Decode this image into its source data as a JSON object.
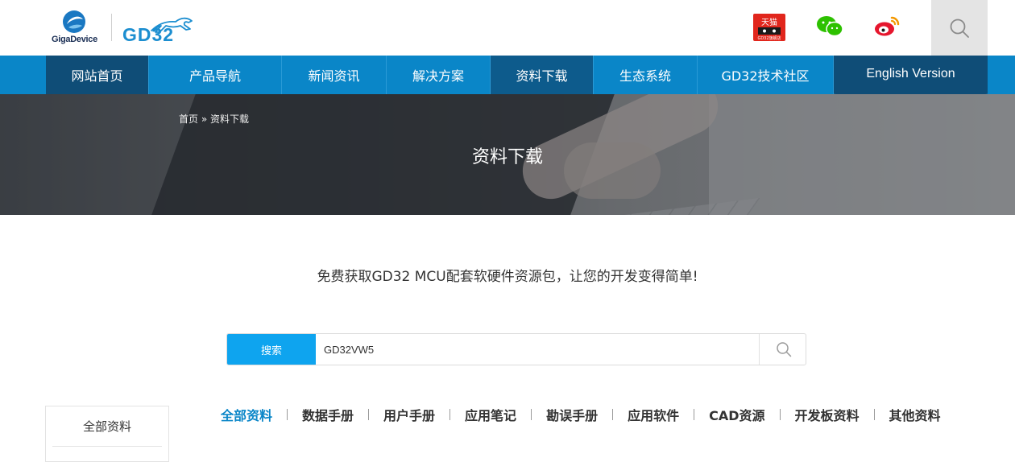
{
  "header": {
    "logo_giga_text": "GigaDevice",
    "logo_gd32_text": "GD32",
    "tmall_label": "天猫",
    "tmall_sub": "GD32旗舰店",
    "colors": {
      "brand_blue": "#0a86c8",
      "nav_dark": "#0f4d77",
      "search_button": "#0ea4ef"
    }
  },
  "nav": {
    "items": [
      {
        "label": "网站首页"
      },
      {
        "label": "产品导航"
      },
      {
        "label": "新闻资讯"
      },
      {
        "label": "解决方案"
      },
      {
        "label": "资料下载"
      },
      {
        "label": "生态系统"
      },
      {
        "label": "GD32技术社区"
      }
    ],
    "english": "English Version"
  },
  "banner": {
    "breadcrumb": "首页 » 资料下载",
    "title": "资料下载"
  },
  "main": {
    "tagline": "免费获取GD32 MCU配套软硬件资源包，让您的开发变得简单!",
    "search": {
      "button_label": "搜索",
      "value": "GD32VW5"
    },
    "sidebar": {
      "first_item": "全部资料"
    },
    "tabs": [
      {
        "label": "全部资料"
      },
      {
        "label": "数据手册"
      },
      {
        "label": "用户手册"
      },
      {
        "label": "应用笔记"
      },
      {
        "label": "勘误手册"
      },
      {
        "label": "应用软件"
      },
      {
        "label": "CAD资源"
      },
      {
        "label": "开发板资料"
      },
      {
        "label": "其他资料"
      }
    ]
  }
}
